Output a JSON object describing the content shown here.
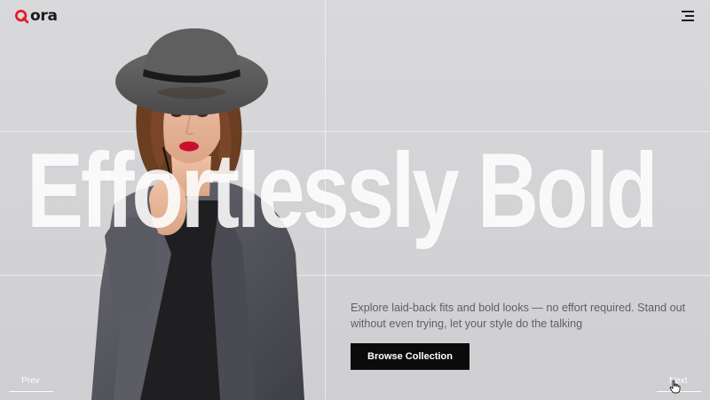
{
  "brand": {
    "logo_text": "ora",
    "logo_mark": "Q",
    "accent_color": "#e31b23"
  },
  "header": {
    "menu_icon": "hamburger-menu-icon"
  },
  "hero": {
    "headline": "Effortlessly Bold",
    "description": "Explore laid-back fits and bold looks — no effort required. Stand out without even trying, let your style do the talking",
    "cta_label": "Browse Collection",
    "image": "model-in-wide-brim-hat-and-leather-jacket"
  },
  "slider": {
    "prev_label": "Prev",
    "next_label": "Next"
  },
  "colors": {
    "background": "#d6d6d9",
    "button": "#0b0b0b",
    "headline": "#ffffff"
  }
}
